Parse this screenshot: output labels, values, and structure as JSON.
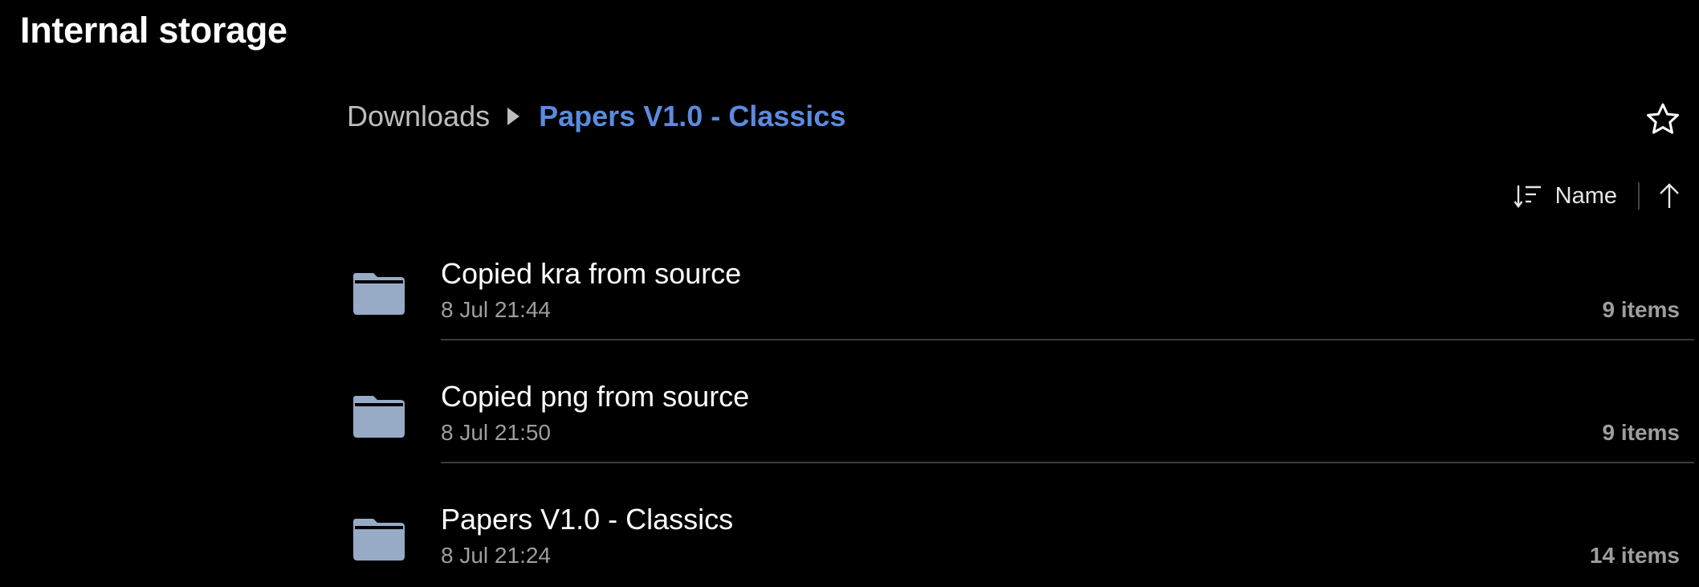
{
  "app": {
    "title": "Internal storage"
  },
  "breadcrumb": {
    "parent": "Downloads",
    "current": "Papers V1.0 - Classics"
  },
  "toolbar": {
    "favorite_icon": "star-outline-icon"
  },
  "sort": {
    "label": "Name",
    "sort_icon": "sort-lines-icon",
    "direction_icon": "arrow-up-icon"
  },
  "files": [
    {
      "name": "Copied kra from source",
      "date": "8 Jul 21:44",
      "count": "9 items",
      "icon": "folder-icon"
    },
    {
      "name": "Copied png from source",
      "date": "8 Jul 21:50",
      "count": "9 items",
      "icon": "folder-icon"
    },
    {
      "name": "Papers V1.0 - Classics",
      "date": "8 Jul 21:24",
      "count": "14 items",
      "icon": "folder-icon"
    }
  ],
  "colors": {
    "background": "#000000",
    "accent": "#5b8be0",
    "folder": "#97abc7",
    "secondary_text": "#9e9e9e"
  }
}
